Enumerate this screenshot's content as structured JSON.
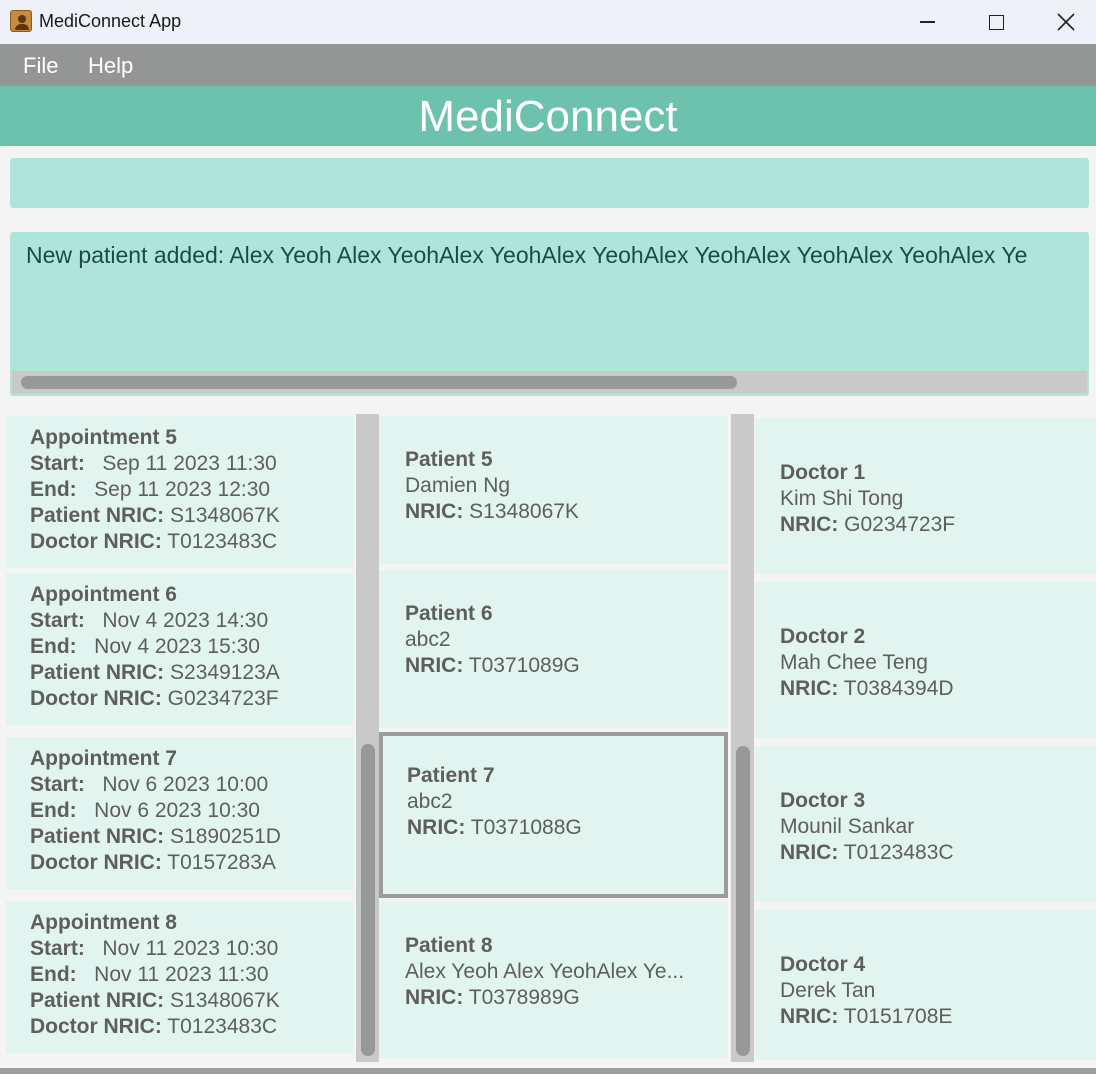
{
  "window": {
    "title": "MediConnect App"
  },
  "menu": {
    "file": "File",
    "help": "Help"
  },
  "header": {
    "title": "MediConnect"
  },
  "command": {
    "value": "",
    "placeholder": ""
  },
  "result": {
    "text": "New patient added: Alex Yeoh Alex YeohAlex YeohAlex YeohAlex YeohAlex YeohAlex YeohAlex Ye"
  },
  "labels": {
    "start": "Start:",
    "end": "End:",
    "patient_nric": "Patient NRIC:",
    "doctor_nric": "Doctor NRIC:",
    "nric": "NRIC:"
  },
  "appointments": [
    {
      "title": "Appointment 5",
      "start": "Sep 11 2023 11:30",
      "end": "Sep 11 2023 12:30",
      "patient_nric": "S1348067K",
      "doctor_nric": "T0123483C"
    },
    {
      "title": "Appointment 6",
      "start": "Nov 4 2023 14:30",
      "end": "Nov 4 2023 15:30",
      "patient_nric": "S2349123A",
      "doctor_nric": "G0234723F"
    },
    {
      "title": "Appointment 7",
      "start": "Nov 6 2023 10:00",
      "end": "Nov 6 2023 10:30",
      "patient_nric": "S1890251D",
      "doctor_nric": "T0157283A"
    },
    {
      "title": "Appointment 8",
      "start": "Nov 11 2023 10:30",
      "end": "Nov 11 2023 11:30",
      "patient_nric": "S1348067K",
      "doctor_nric": "T0123483C"
    }
  ],
  "patients": [
    {
      "title": "Patient 5",
      "name": "Damien Ng",
      "nric": "S1348067K",
      "selected": false
    },
    {
      "title": "Patient 6",
      "name": "abc2",
      "nric": "T0371089G",
      "selected": false
    },
    {
      "title": "Patient 7",
      "name": "abc2",
      "nric": "T0371088G",
      "selected": true
    },
    {
      "title": "Patient 8",
      "name": "Alex Yeoh Alex YeohAlex Ye...",
      "nric": "T0378989G",
      "selected": false
    }
  ],
  "doctors": [
    {
      "title": "Doctor 1",
      "name": "Kim Shi Tong",
      "nric": "G0234723F"
    },
    {
      "title": "Doctor 2",
      "name": "Mah Chee Teng",
      "nric": "T0384394D"
    },
    {
      "title": "Doctor 3",
      "name": "Mounil Sankar",
      "nric": "T0123483C"
    },
    {
      "title": "Doctor 4",
      "name": "Derek Tan",
      "nric": "T0151708E"
    }
  ]
}
